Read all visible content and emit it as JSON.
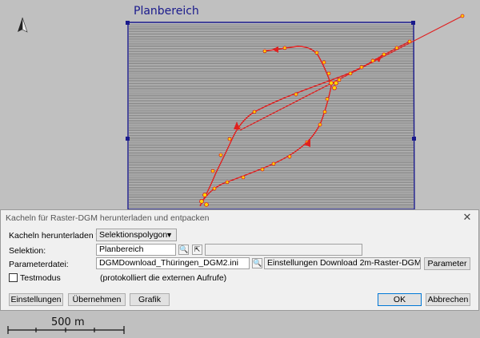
{
  "map": {
    "title": "Planbereich",
    "scale_label": "500 m",
    "colors": {
      "frame": "#1a1a8c",
      "route": "#e02020",
      "marker": "#ffd700",
      "background": "#c0c0c0"
    }
  },
  "dialog": {
    "title": "Kacheln für Raster-DGM herunterladen und entpacken",
    "close_label": "✕",
    "download_label": "Kacheln herunterladen für:",
    "download_value": "Selektionspolygon",
    "selection_label": "Selektion:",
    "selection_value": "Planbereich",
    "selection_extra": "",
    "paramfile_label": "Parameterdatei:",
    "paramfile_value": "DGMDownload_Thüringen_DGM2.ini",
    "paramfile_desc": "Einstellungen Download 2m-Raster-DGM",
    "parameter_button": "Parameter",
    "testmode_label": "Testmodus",
    "testmode_note": "(protokolliert die externen Aufrufe)",
    "buttons": {
      "settings": "Einstellungen",
      "apply": "Übernehmen",
      "graphic": "Grafik",
      "ok": "OK",
      "cancel": "Abbrechen"
    }
  }
}
